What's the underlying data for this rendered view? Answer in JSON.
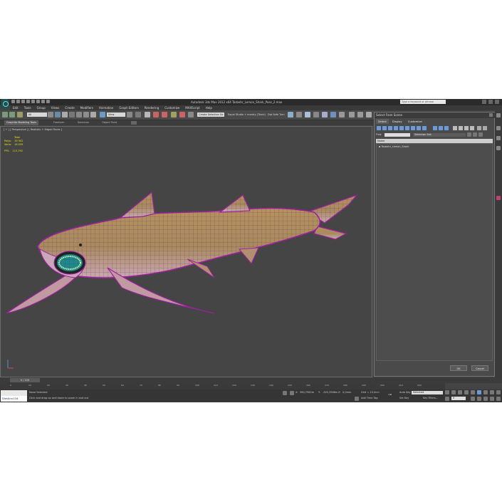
{
  "window": {
    "title": "Autodesk 3ds Max 2012 x64      Tasbehr_Lemon_Shark_Pose_2.max",
    "search_placeholder": "Type a keyword or phrase"
  },
  "menu": [
    "Edit",
    "Tools",
    "Group",
    "Views",
    "Create",
    "Modifiers",
    "Animation",
    "Graph Editors",
    "Rendering",
    "Customize",
    "MAXScript",
    "Help"
  ],
  "toolbar": {
    "filter_value": "All",
    "view_value": "View",
    "selection_set_placeholder": "Create Selection Se",
    "render_preset": "Equal Studio + mentry (Track)",
    "safe_frame_label": "Dot Safe Turn"
  },
  "ribbon": {
    "tabs": [
      "Graphite Modeling Tools",
      "Freeform",
      "Selection",
      "Object Paint"
    ]
  },
  "viewport": {
    "label": "[ + ] [ Perspective ] [ Realistic + Edged Faces ]",
    "stats": {
      "total_label": "Total",
      "polys_label": "Polys:",
      "polys_value": "19 002",
      "verts_label": "Verts:",
      "verts_value": "16 039",
      "fps_label": "FPS:",
      "fps_value": "113,792"
    }
  },
  "select_panel": {
    "title": "Select From Scene",
    "tabs": [
      "Select",
      "Display",
      "Customize"
    ],
    "find_label": "Find:",
    "selection_sets_label": "Selection Set:",
    "column_name": "Name",
    "items": [
      "Tasbehr_Lemon_Shark"
    ],
    "ok_label": "OK",
    "cancel_label": "Cancel"
  },
  "timeline": {
    "position_label": "0 / 220",
    "ticks": [
      "0",
      "10",
      "20",
      "30",
      "40",
      "50",
      "60",
      "70",
      "80",
      "90",
      "100",
      "110",
      "120",
      "130",
      "140",
      "150",
      "160",
      "170",
      "180",
      "190",
      "200",
      "210",
      "220"
    ]
  },
  "status": {
    "maxscript_text": "DietAnn116",
    "selection_text": "None Selected",
    "prompt_text": "Click and drag up and down to zoom in and out",
    "x_label": "X:",
    "y_label": "Y:",
    "z_label": "Z:",
    "x_value": "360,7582m",
    "y_value": "-345,3566m",
    "z_value": "0,0mm",
    "grid_text": "Grid = 10,0cm",
    "add_time_tag": "Add Time Tag",
    "auto_key_label": "Auto Key",
    "set_key_label": "Set Key",
    "selected_option": "Selected",
    "key_filters_label": "Key Filters...",
    "frame_value": "0"
  }
}
